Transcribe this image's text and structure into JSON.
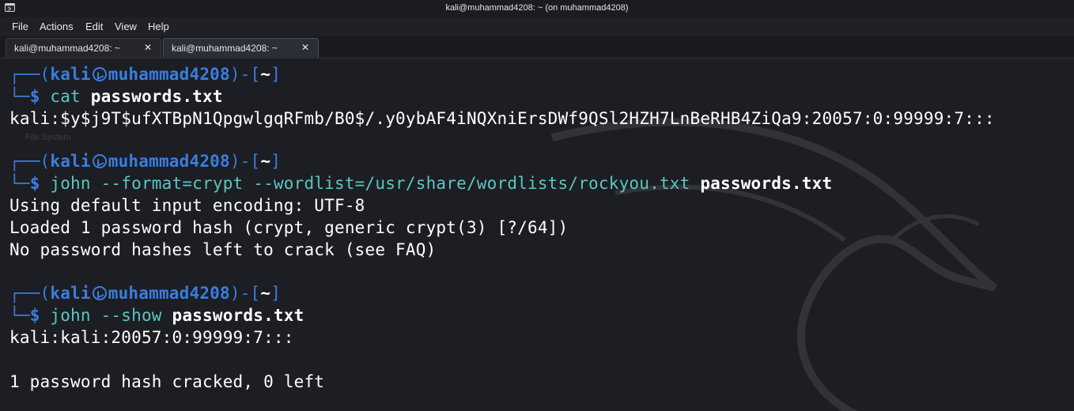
{
  "window": {
    "title": "kali@muhammad4208: ~ (on muhammad4208)",
    "icon": "terminal-icon"
  },
  "menu": [
    "File",
    "Actions",
    "Edit",
    "View",
    "Help"
  ],
  "tabs": [
    {
      "label": "kali@muhammad4208: ~",
      "close": "✕",
      "active": false
    },
    {
      "label": "kali@muhammad4208: ~",
      "close": "✕",
      "active": true
    }
  ],
  "colors": {
    "prompt_blue": "#3a7de0",
    "command_teal": "#5ac7c1",
    "background": "#1c1e23",
    "text": "#ffffff"
  },
  "prompt": {
    "user": "kali",
    "host": "muhammad4208",
    "dir": "~",
    "symbol": "$"
  },
  "blocks": [
    {
      "command": "cat",
      "file": "passwords.txt",
      "output": [
        "kali:$y$j9T$ufXTBpN1QpgwlgqRFmb/B0$/.y0ybAF4iNQXniErsDWf9QSl2HZH7LnBeRHB4ZiQa9:20057:0:99999:7:::"
      ]
    },
    {
      "command": "john --format=crypt --wordlist=/usr/share/wordlists/rockyou.txt",
      "file": "passwords.txt",
      "output": [
        "Using default input encoding: UTF-8",
        "Loaded 1 password hash (crypt, generic crypt(3) [?/64])",
        "No password hashes left to crack (see FAQ)"
      ]
    },
    {
      "command": "john --show",
      "file": "passwords.txt",
      "output": [
        "kali:kali:20057:0:99999:7:::",
        "",
        "1 password hash cracked, 0 left"
      ]
    }
  ],
  "background_text": [
    "File System"
  ]
}
